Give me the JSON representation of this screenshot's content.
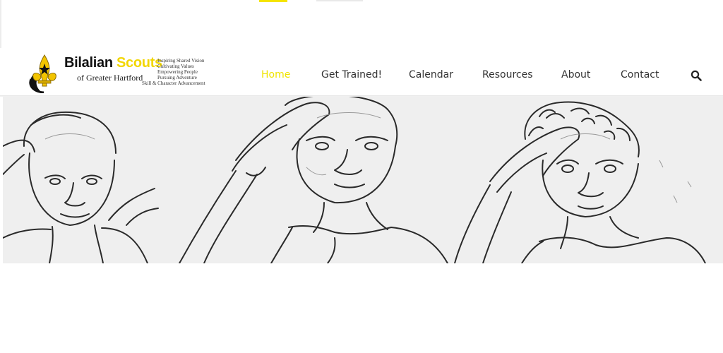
{
  "brand": {
    "name_part1": "Bilalian",
    "name_part2": "Scouts",
    "subtitle": "of Greater Hartford",
    "taglines": [
      "Inspiring Shared Vision",
      "Cultivating Values",
      "Empowering People",
      "Pursuing Adventure",
      "Skill & Character Advancement"
    ],
    "colors": {
      "accent": "#f0e400",
      "text": "#333333",
      "logo_black": "#111111"
    }
  },
  "nav": {
    "items": [
      {
        "label": "Home",
        "active": true
      },
      {
        "label": "Get Trained!",
        "active": false
      },
      {
        "label": "Calendar",
        "active": false
      },
      {
        "label": "Resources",
        "active": false
      },
      {
        "label": "About",
        "active": false
      },
      {
        "label": "Contact",
        "active": false
      }
    ],
    "search_icon": "search-icon"
  },
  "hero": {
    "image": "pencil sketch of three saluting scouts",
    "icon": "hero-sketch-image"
  }
}
